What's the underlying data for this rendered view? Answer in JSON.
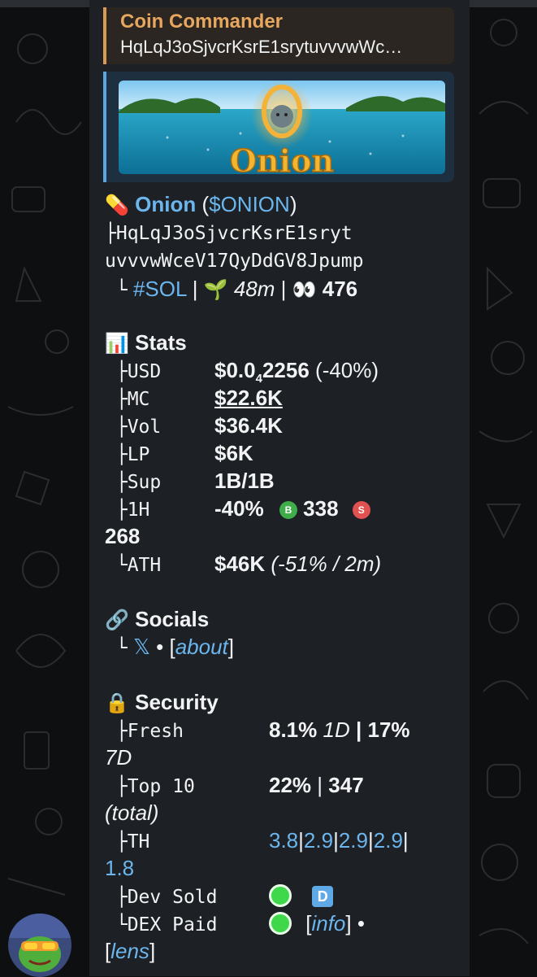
{
  "reply": {
    "name": "Coin Commander",
    "text": "HqLqJ3oSjvcrKsrE1srytuvvvwWc…"
  },
  "banner": {
    "text": "Onion"
  },
  "token": {
    "pill_icon": "💊",
    "name": "Onion",
    "ticker": "($ONION)",
    "address_line1": "├HqLqJ3oSjvcrKsrE1sryt",
    "address_line2": "uvvvwWceV17QyDdGV8Jpump",
    "chain": "#SOL",
    "sprout_icon": "🌱",
    "age": "48m",
    "eyes_icon": "👀",
    "views": "476"
  },
  "stats": {
    "icon": "📊",
    "title": "Stats",
    "usd_label": "USD",
    "usd_value_a": "$0.0",
    "usd_sub": "4",
    "usd_value_b": "2256",
    "usd_change": "(-40%)",
    "mc_label": "MC",
    "mc_value": "$22.6K",
    "vol_label": "Vol",
    "vol_value": "$36.4K",
    "lp_label": "LP",
    "lp_value": "$6K",
    "sup_label": "Sup",
    "sup_value": "1B/1B",
    "h1_label": "1H",
    "h1_change": "-40%",
    "buy_badge": "B",
    "buys": "338",
    "sell_badge": "S",
    "sells": "268",
    "ath_label": "ATH",
    "ath_value": "$46K",
    "ath_detail": "(-51% / 2m)"
  },
  "socials": {
    "icon": "🔗",
    "title": "Socials",
    "x_link": "𝕏",
    "about_link": "about"
  },
  "security": {
    "icon": "🔒",
    "title": "Security",
    "fresh_label": "Fresh",
    "fresh_1d": "8.1%",
    "fresh_1d_unit": "1D",
    "fresh_7d": "17%",
    "fresh_7d_unit": "7D",
    "top10_label": "Top 10",
    "top10_pct": "22%",
    "top10_count": "347",
    "top10_total": "(total)",
    "th_label": "TH",
    "th_values": [
      "3.8",
      "2.9",
      "2.9",
      "2.9",
      "1.8"
    ],
    "dev_label": "Dev Sold",
    "dev_badge": "D",
    "dex_label": "DEX Paid",
    "info_link": "info",
    "lens_link": "lens"
  },
  "colors": {
    "accent_link": "#6cb6ee",
    "reply_accent": "#d99a51",
    "bubble": "#1d2024",
    "buy": "#3fae4a",
    "sell": "#e05151"
  }
}
